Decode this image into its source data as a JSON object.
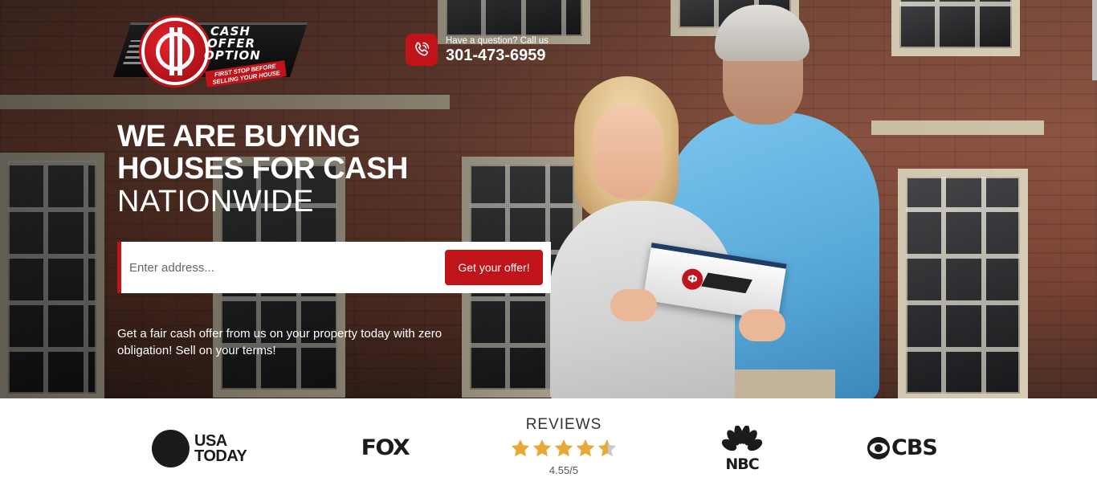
{
  "brand": {
    "logo_line1": "CASH",
    "logo_line2": "OFFER",
    "logo_line3": "OPTION",
    "tagline_line1": "FIRST STOP BEFORE",
    "tagline_line2": "SELLING YOUR HOUSE",
    "accent_color": "#c0141b"
  },
  "contact": {
    "question": "Have a question? Call us",
    "phone": "301-473-6959",
    "icon": "phone-icon"
  },
  "hero": {
    "headline_line1": "WE ARE BUYING",
    "headline_line2": "HOUSES FOR CASH",
    "headline_line3": "NATIONWIDE",
    "address_placeholder": "Enter address...",
    "submit_label": "Get your offer!",
    "blurb": "Get a fair cash offer from us on your property today with zero obligation! Sell on your terms!"
  },
  "media": {
    "usa_today_line1": "USA",
    "usa_today_line2": "TODAY",
    "fox": "FOX",
    "reviews_title": "REVIEWS",
    "reviews_score": "4.55/5",
    "reviews_rating": 4.55,
    "nbc": "NBC",
    "cbs": "CBS",
    "star_color": "#e8a838"
  },
  "brochure_mark": "Ф"
}
